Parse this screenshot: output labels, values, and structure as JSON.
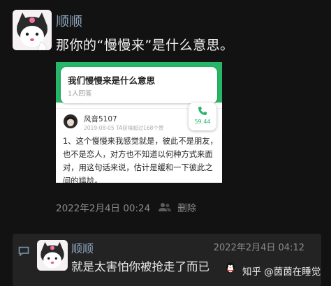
{
  "post": {
    "author": "顺顺",
    "text": "那你的“慢慢来”是什么意思。",
    "timestamp": "2022年2月4日 00:24",
    "delete_label": "删除",
    "avatar_icon": "kuromi-avatar"
  },
  "embed": {
    "question_title": "我们慢慢来是什么意思",
    "answer_count": "1人回答",
    "answerer_name": "风音5107",
    "answer_meta": "2019-08-05 TA获得超过168个赞",
    "answer_body": "1、这个慢慢来我感觉就是，彼此不是朋友，也不是恋人，对方也不知道以何种方式来面对，用这句话来说，估计是缓和一下彼此之间的尴尬。",
    "call_time": "59:44",
    "accent_color": "#27b768"
  },
  "reply": {
    "author": "顺顺",
    "timestamp": "2022年2月4日 04:12",
    "text": "就是太害怕你被抢走了而已"
  },
  "watermark": {
    "text": "知乎 @茵茵在睡觉"
  },
  "colors": {
    "background": "#121212",
    "author_name": "#8ea4bd",
    "meta": "#8a8a8a",
    "reply_bg": "#232323"
  }
}
